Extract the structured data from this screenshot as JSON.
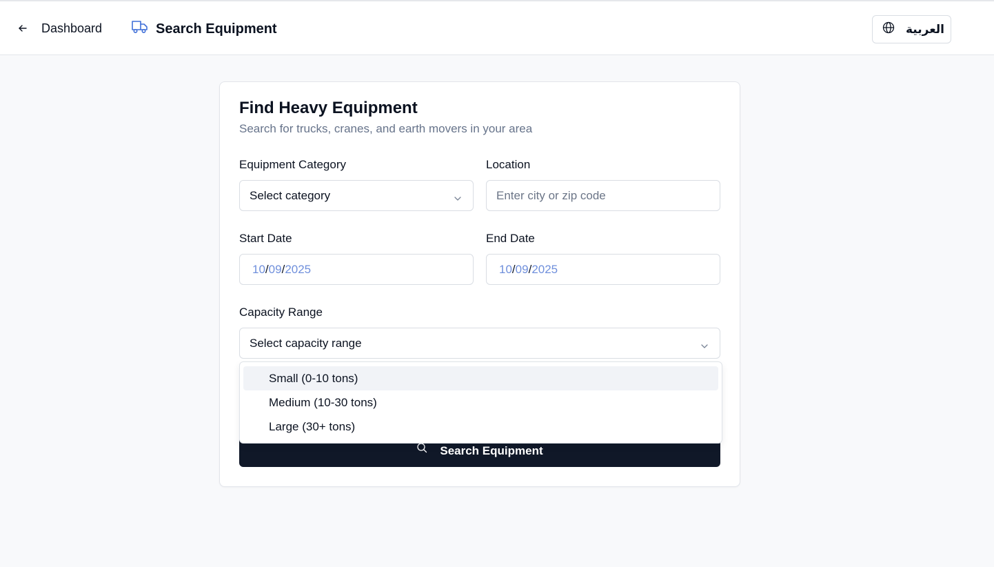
{
  "header": {
    "back_label": "Dashboard",
    "page_title": "Search Equipment",
    "language_button": "العربية"
  },
  "card": {
    "title": "Find Heavy Equipment",
    "subtitle": "Search for trucks, cranes, and earth movers in your area"
  },
  "form": {
    "category": {
      "label": "Equipment Category",
      "value": "Select category"
    },
    "location": {
      "label": "Location",
      "placeholder": "Enter city or zip code"
    },
    "start_date": {
      "label": "Start Date",
      "month": "10",
      "day": "09",
      "year": "2025"
    },
    "end_date": {
      "label": "End Date",
      "month": "10",
      "day": "09",
      "year": "2025"
    },
    "capacity": {
      "label": "Capacity Range",
      "value": "Select capacity range",
      "options": [
        "Small (0-10 tons)",
        "Medium (10-30 tons)",
        "Large (30+ tons)"
      ],
      "highlighted_index": 0
    },
    "submit_label": "Search Equipment"
  },
  "colors": {
    "accent_icon": "#3f6fd8",
    "button_bg": "#101828",
    "date_segment": "#6f8fdc"
  },
  "icons": {
    "back": "arrow-left-icon",
    "title": "truck-icon",
    "language": "globe-icon",
    "select": "chevron-down-icon",
    "submit": "search-icon"
  }
}
